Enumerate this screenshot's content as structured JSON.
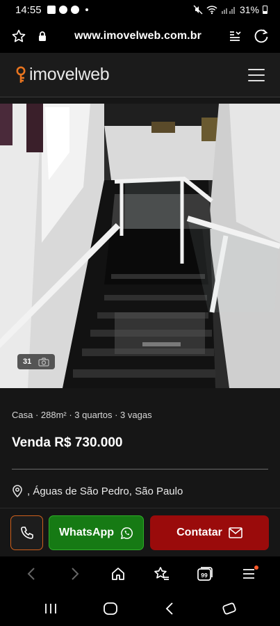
{
  "status_bar": {
    "time": "14:55",
    "battery": "31%"
  },
  "browser": {
    "url": "www.imovelweb.com.br",
    "tabs_count": "99"
  },
  "site": {
    "logo_text": "imovelweb"
  },
  "listing": {
    "photo_count": "31",
    "features": "Casa · 288m² · 3 quartos · 3 vagas",
    "price": "Venda R$ 730.000",
    "location": ", Águas de São Pedro, São Paulo"
  },
  "actions": {
    "whatsapp_label": "WhatsApp",
    "contact_label": "Contatar"
  },
  "colors": {
    "brand_orange": "#e8741f",
    "whatsapp_green": "#167a14",
    "contact_red": "#9a0b0b"
  }
}
